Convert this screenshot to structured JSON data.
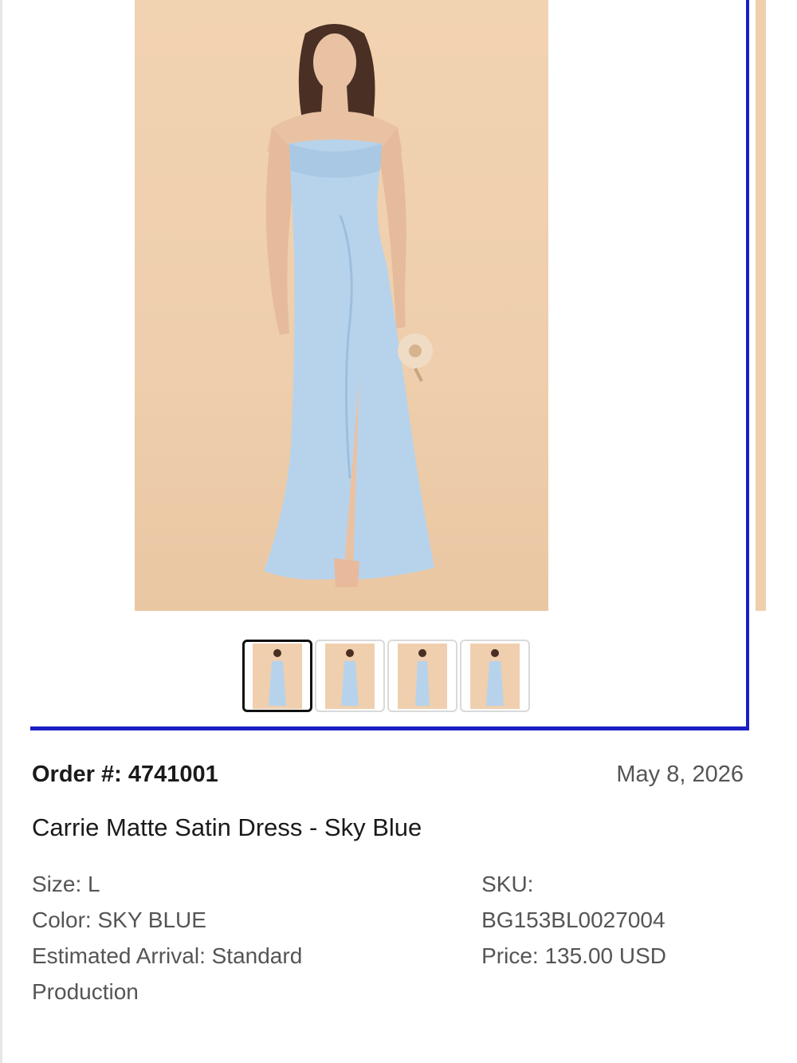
{
  "gallery": {
    "main_image": "product-photo",
    "thumbnails": [
      "thumbnail-front",
      "thumbnail-back",
      "thumbnail-side",
      "thumbnail-back-alt"
    ],
    "accent_color": "#1a1fc4",
    "photo_background": "#efcfae",
    "dress_color": "#b7d3ec"
  },
  "order": {
    "label": "Order #: 4741001",
    "date": "May 8, 2026"
  },
  "product": {
    "name": "Carrie Matte Satin Dress - Sky Blue"
  },
  "details": {
    "size": "Size: L",
    "color": "Color: SKY BLUE",
    "arrival_line1": "Estimated Arrival: Standard",
    "arrival_line2": "Production",
    "sku_label": "SKU:",
    "sku_value": "BG153BL0027004",
    "price": "Price: 135.00 USD"
  }
}
